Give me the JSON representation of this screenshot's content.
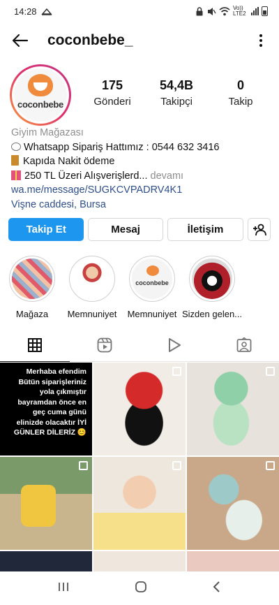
{
  "status_bar": {
    "time": "14:28",
    "net_label": "Vo)) LTE2"
  },
  "header": {
    "username": "coconbebe_"
  },
  "profile": {
    "avatar_text": "coconbebe",
    "stats": [
      {
        "value": "175",
        "label": "Gönderi"
      },
      {
        "value": "54,4B",
        "label": "Takipçi"
      },
      {
        "value": "0",
        "label": "Takip"
      }
    ],
    "category": "Giyim Mağazası",
    "bio_line1": "Whatsapp Sipariş Hattımız : 0544 632 3416",
    "bio_line2": "Kapıda Nakit ödeme",
    "bio_line3": "250 TL Üzeri Alışverişlerd...",
    "bio_more": " devamı",
    "link": "wa.me/message/SUGKCVPADRV4K1",
    "location": "Vişne caddesi, Bursa"
  },
  "actions": {
    "follow": "Takip Et",
    "message": "Mesaj",
    "contact": "İletişim"
  },
  "highlights": [
    {
      "label": "Mağaza"
    },
    {
      "label": "Memnuniyet"
    },
    {
      "label": "Memnuniyet",
      "image_text": "coconbebe"
    },
    {
      "label": "Sizden gelen..."
    }
  ],
  "posts": {
    "announcement": "Merhaba efendim Bütün siparişleriniz yola çıkmıştır bayramdan önce en geç cuma günü elinizde olacaktır İYİ GÜNLER DİLERİZ 😊"
  },
  "icons": [
    "back-arrow-icon",
    "more-icon",
    "add-person-icon",
    "grid-icon",
    "reels-icon",
    "video-icon",
    "tagged-icon",
    "multi-post-icon"
  ],
  "colors": {
    "primary_button": "#1d96f0",
    "link": "#2e4f8a",
    "muted": "#8e8e8e"
  }
}
